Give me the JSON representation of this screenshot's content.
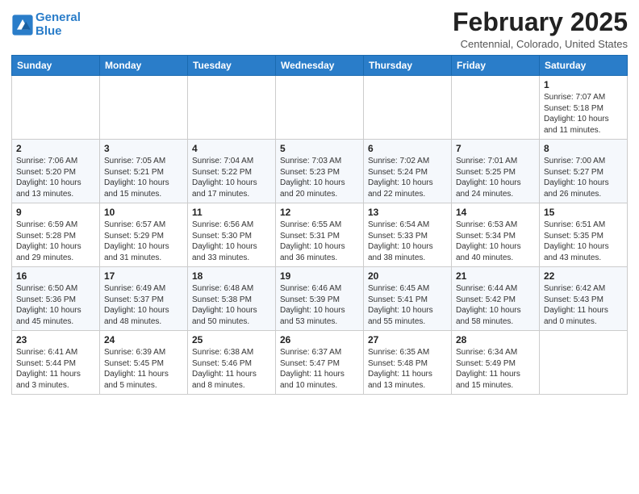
{
  "header": {
    "logo_line1": "General",
    "logo_line2": "Blue",
    "month": "February 2025",
    "location": "Centennial, Colorado, United States"
  },
  "weekdays": [
    "Sunday",
    "Monday",
    "Tuesday",
    "Wednesday",
    "Thursday",
    "Friday",
    "Saturday"
  ],
  "weeks": [
    [
      {
        "day": "",
        "info": ""
      },
      {
        "day": "",
        "info": ""
      },
      {
        "day": "",
        "info": ""
      },
      {
        "day": "",
        "info": ""
      },
      {
        "day": "",
        "info": ""
      },
      {
        "day": "",
        "info": ""
      },
      {
        "day": "1",
        "info": "Sunrise: 7:07 AM\nSunset: 5:18 PM\nDaylight: 10 hours and 11 minutes."
      }
    ],
    [
      {
        "day": "2",
        "info": "Sunrise: 7:06 AM\nSunset: 5:20 PM\nDaylight: 10 hours and 13 minutes."
      },
      {
        "day": "3",
        "info": "Sunrise: 7:05 AM\nSunset: 5:21 PM\nDaylight: 10 hours and 15 minutes."
      },
      {
        "day": "4",
        "info": "Sunrise: 7:04 AM\nSunset: 5:22 PM\nDaylight: 10 hours and 17 minutes."
      },
      {
        "day": "5",
        "info": "Sunrise: 7:03 AM\nSunset: 5:23 PM\nDaylight: 10 hours and 20 minutes."
      },
      {
        "day": "6",
        "info": "Sunrise: 7:02 AM\nSunset: 5:24 PM\nDaylight: 10 hours and 22 minutes."
      },
      {
        "day": "7",
        "info": "Sunrise: 7:01 AM\nSunset: 5:25 PM\nDaylight: 10 hours and 24 minutes."
      },
      {
        "day": "8",
        "info": "Sunrise: 7:00 AM\nSunset: 5:27 PM\nDaylight: 10 hours and 26 minutes."
      }
    ],
    [
      {
        "day": "9",
        "info": "Sunrise: 6:59 AM\nSunset: 5:28 PM\nDaylight: 10 hours and 29 minutes."
      },
      {
        "day": "10",
        "info": "Sunrise: 6:57 AM\nSunset: 5:29 PM\nDaylight: 10 hours and 31 minutes."
      },
      {
        "day": "11",
        "info": "Sunrise: 6:56 AM\nSunset: 5:30 PM\nDaylight: 10 hours and 33 minutes."
      },
      {
        "day": "12",
        "info": "Sunrise: 6:55 AM\nSunset: 5:31 PM\nDaylight: 10 hours and 36 minutes."
      },
      {
        "day": "13",
        "info": "Sunrise: 6:54 AM\nSunset: 5:33 PM\nDaylight: 10 hours and 38 minutes."
      },
      {
        "day": "14",
        "info": "Sunrise: 6:53 AM\nSunset: 5:34 PM\nDaylight: 10 hours and 40 minutes."
      },
      {
        "day": "15",
        "info": "Sunrise: 6:51 AM\nSunset: 5:35 PM\nDaylight: 10 hours and 43 minutes."
      }
    ],
    [
      {
        "day": "16",
        "info": "Sunrise: 6:50 AM\nSunset: 5:36 PM\nDaylight: 10 hours and 45 minutes."
      },
      {
        "day": "17",
        "info": "Sunrise: 6:49 AM\nSunset: 5:37 PM\nDaylight: 10 hours and 48 minutes."
      },
      {
        "day": "18",
        "info": "Sunrise: 6:48 AM\nSunset: 5:38 PM\nDaylight: 10 hours and 50 minutes."
      },
      {
        "day": "19",
        "info": "Sunrise: 6:46 AM\nSunset: 5:39 PM\nDaylight: 10 hours and 53 minutes."
      },
      {
        "day": "20",
        "info": "Sunrise: 6:45 AM\nSunset: 5:41 PM\nDaylight: 10 hours and 55 minutes."
      },
      {
        "day": "21",
        "info": "Sunrise: 6:44 AM\nSunset: 5:42 PM\nDaylight: 10 hours and 58 minutes."
      },
      {
        "day": "22",
        "info": "Sunrise: 6:42 AM\nSunset: 5:43 PM\nDaylight: 11 hours and 0 minutes."
      }
    ],
    [
      {
        "day": "23",
        "info": "Sunrise: 6:41 AM\nSunset: 5:44 PM\nDaylight: 11 hours and 3 minutes."
      },
      {
        "day": "24",
        "info": "Sunrise: 6:39 AM\nSunset: 5:45 PM\nDaylight: 11 hours and 5 minutes."
      },
      {
        "day": "25",
        "info": "Sunrise: 6:38 AM\nSunset: 5:46 PM\nDaylight: 11 hours and 8 minutes."
      },
      {
        "day": "26",
        "info": "Sunrise: 6:37 AM\nSunset: 5:47 PM\nDaylight: 11 hours and 10 minutes."
      },
      {
        "day": "27",
        "info": "Sunrise: 6:35 AM\nSunset: 5:48 PM\nDaylight: 11 hours and 13 minutes."
      },
      {
        "day": "28",
        "info": "Sunrise: 6:34 AM\nSunset: 5:49 PM\nDaylight: 11 hours and 15 minutes."
      },
      {
        "day": "",
        "info": ""
      }
    ]
  ]
}
